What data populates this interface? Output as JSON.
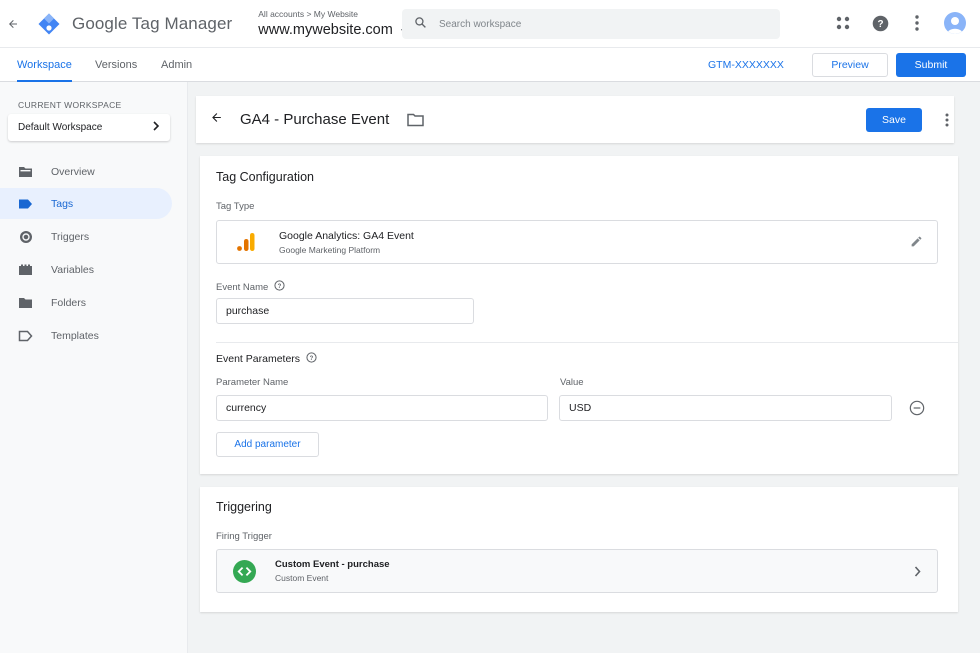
{
  "app": {
    "name": "Google Tag Manager",
    "breadcrumb": "All accounts > My Website",
    "container": "www.mywebsite.com"
  },
  "search": {
    "placeholder": "Search workspace"
  },
  "nav": {
    "tabs": [
      {
        "label": "Workspace",
        "active": true
      },
      {
        "label": "Versions",
        "active": false
      },
      {
        "label": "Admin",
        "active": false
      }
    ],
    "container_id": "GTM-XXXXXXX",
    "preview_label": "Preview",
    "submit_label": "Submit"
  },
  "sidebar": {
    "workspace_label": "CURRENT WORKSPACE",
    "workspace_name": "Default Workspace",
    "items": [
      {
        "label": "Overview",
        "icon": "overview-icon",
        "active": false
      },
      {
        "label": "Tags",
        "icon": "tag-icon",
        "active": true
      },
      {
        "label": "Triggers",
        "icon": "trigger-icon",
        "active": false
      },
      {
        "label": "Variables",
        "icon": "variables-icon",
        "active": false
      },
      {
        "label": "Folders",
        "icon": "folder-icon",
        "active": false
      },
      {
        "label": "Templates",
        "icon": "template-icon",
        "active": false
      }
    ]
  },
  "tag": {
    "title": "GA4 - Purchase Event",
    "save_label": "Save"
  },
  "config": {
    "title": "Tag Configuration",
    "tag_type_label": "Tag Type",
    "tag_type_name": "Google Analytics: GA4 Event",
    "tag_type_vendor": "Google Marketing Platform",
    "event_name_label": "Event Name",
    "event_name_value": "purchase",
    "params_label": "Event Parameters",
    "param_name_header": "Parameter Name",
    "value_header": "Value",
    "param_name_value": "currency",
    "param_value_value": "USD",
    "add_param_label": "Add parameter"
  },
  "triggering": {
    "title": "Triggering",
    "firing_label": "Firing Trigger",
    "trigger_name": "Custom Event - purchase",
    "trigger_type": "Custom Event"
  },
  "colors": {
    "primary": "#1a73e8",
    "ga_orange": "#f9ab00",
    "ga_dark_orange": "#e37400",
    "trigger_green": "#34a853"
  }
}
